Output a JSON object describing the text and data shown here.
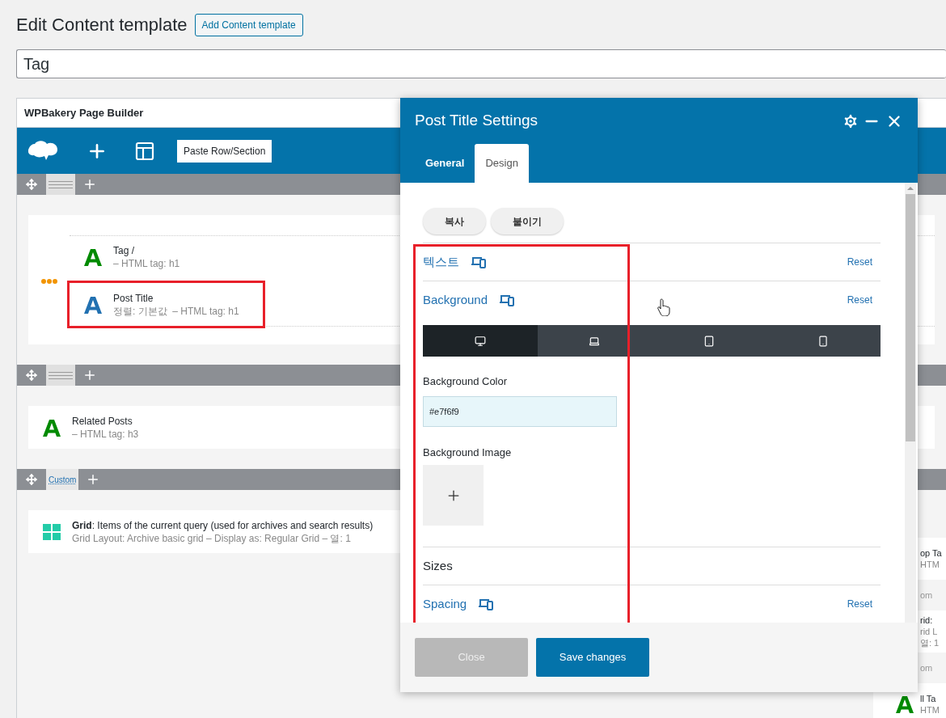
{
  "page": {
    "title": "Edit Content template",
    "add_button": "Add Content template",
    "title_field": "Tag"
  },
  "builder": {
    "title": "WPBakery Page Builder",
    "paste_button": "Paste Row/Section",
    "rows": [
      {
        "label": null,
        "groups": [
          {
            "elements": [
              {
                "kind": "text",
                "color": "#008a00",
                "title": "Tag /",
                "meta": "– HTML tag: h1",
                "highlighted": false
              },
              {
                "kind": "text",
                "color": "#2271b1",
                "title": "Post Title",
                "meta": "정렬: 기본값  – HTML tag: h1",
                "highlighted": true
              }
            ]
          }
        ]
      },
      {
        "label": null,
        "elements": [
          {
            "kind": "text",
            "color": "#008a00",
            "title": "Related Posts",
            "meta": "– HTML tag: h3",
            "highlighted": false
          }
        ]
      },
      {
        "label": "Custom",
        "elements": [
          {
            "kind": "grid",
            "color": "#23cca8",
            "title": "**Grid**: Items of the current query (used for archives and search results)",
            "meta": "Grid Layout: Archive basic grid – Display as: Regular Grid – 열: 1",
            "highlighted": false
          }
        ],
        "side": [
          {
            "kind": "element",
            "lines": [
              "op Ta",
              "HTM"
            ]
          },
          {
            "kind": "bar",
            "lines": [
              "om"
            ]
          },
          {
            "kind": "element",
            "lines": [
              "rid:",
              "rid L",
              "열: 1"
            ]
          },
          {
            "kind": "bar",
            "lines": [
              "om"
            ]
          },
          {
            "kind": "element",
            "color": "#008a00",
            "lines": [
              "ll Ta",
              "HTM"
            ]
          }
        ]
      }
    ]
  },
  "modal": {
    "title": "Post Title Settings",
    "annotated": true,
    "tabs": [
      {
        "label": "General",
        "selected": false
      },
      {
        "label": "Design",
        "selected": true
      }
    ],
    "clipboard_buttons": [
      "복사",
      "붙이기"
    ],
    "sections": [
      {
        "title": "텍스트",
        "linked": true,
        "responsive": true,
        "reset": "Reset"
      },
      {
        "title": "Background",
        "linked": true,
        "responsive": true,
        "reset": "Reset",
        "body": {
          "devices": [
            {
              "kind": "desktop",
              "selected": true
            },
            {
              "kind": "laptop",
              "selected": false
            },
            {
              "kind": "tablet",
              "selected": false
            },
            {
              "kind": "phone",
              "selected": false
            }
          ],
          "color_label": "Background Color",
          "color_value": "#e7f6f9",
          "image_label": "Background Image"
        }
      },
      {
        "title": "Sizes",
        "linked": false,
        "responsive": false
      },
      {
        "title": "Spacing",
        "linked": true,
        "responsive": true,
        "reset": "Reset"
      }
    ],
    "footer": [
      {
        "label": "Close",
        "disabled": true
      },
      {
        "label": "Save changes",
        "disabled": false
      }
    ]
  }
}
